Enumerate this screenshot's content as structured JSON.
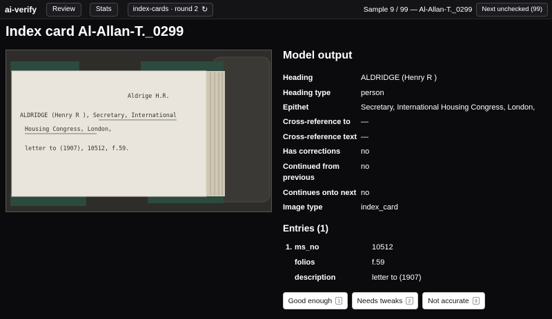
{
  "topbar": {
    "brand": "ai-verify",
    "review_label": "Review",
    "stats_label": "Stats",
    "set_label": "index-cards · round 2",
    "sample_text": "Sample 9 / 99 — Al-Allan-T._0299",
    "next_label": "Next unchecked (99)"
  },
  "page": {
    "title": "Index card Al-Allan-T._0299"
  },
  "card_image": {
    "lines": [
      "Aldrige H.R.",
      "ALDRIDGE (Henry R      ), Secretary, International",
      "Housing Congress, London,",
      "letter to (1907), 10512, f.59."
    ]
  },
  "model_output": {
    "title": "Model output",
    "fields": [
      {
        "label": "Heading",
        "value": "ALDRIDGE (Henry R )"
      },
      {
        "label": "Heading type",
        "value": "person"
      },
      {
        "label": "Epithet",
        "value": "Secretary, International Housing Congress, London,"
      },
      {
        "label": "Cross-reference to",
        "value": "—"
      },
      {
        "label": "Cross-reference text",
        "value": "—"
      },
      {
        "label": "Has corrections",
        "value": "no"
      },
      {
        "label": "Continued from previous",
        "value": "no"
      },
      {
        "label": "Continues onto next",
        "value": "no"
      },
      {
        "label": "Image type",
        "value": "index_card"
      }
    ]
  },
  "entries": {
    "title": "Entries (1)",
    "items": [
      {
        "number": "1.",
        "rows": [
          {
            "label": "ms_no",
            "value": "10512"
          },
          {
            "label": "folios",
            "value": "f.59"
          },
          {
            "label": "description",
            "value": "letter to (1907)"
          }
        ]
      }
    ]
  },
  "actions": [
    {
      "label": "Good enough",
      "key": "1"
    },
    {
      "label": "Needs tweaks",
      "key": "2"
    },
    {
      "label": "Not accurate",
      "key": "3"
    }
  ]
}
